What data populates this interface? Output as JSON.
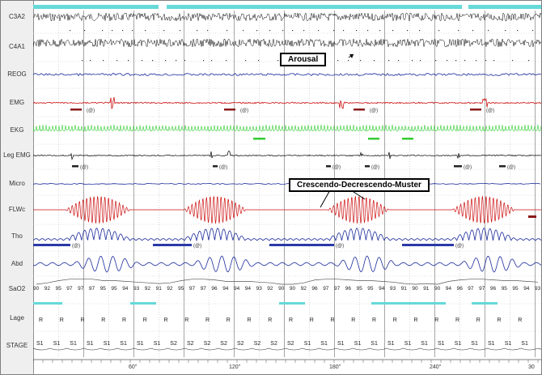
{
  "channels": [
    {
      "name": "C3A2",
      "color": "#000000"
    },
    {
      "name": "C4A1",
      "color": "#000000"
    },
    {
      "name": "REOG",
      "color": "#1a2a9a"
    },
    {
      "name": "EMG",
      "color": "#cc1111"
    },
    {
      "name": "EKG",
      "color": "#33cc33"
    },
    {
      "name": "Leg EMG",
      "color": "#000000"
    },
    {
      "name": "Micro",
      "color": "#1a2a9a"
    },
    {
      "name": "FLWc",
      "color": "#cc1111"
    },
    {
      "name": "Tho",
      "color": "#1a2a9a"
    },
    {
      "name": "Abd",
      "color": "#1a2a9a"
    },
    {
      "name": "SaO2",
      "color": "#000000"
    },
    {
      "name": "Lage",
      "color": "#000000"
    },
    {
      "name": "STAGE",
      "color": "#000000"
    }
  ],
  "annotations": {
    "arousal": "Arousal",
    "crescendo": "Crescendo-Decrescendo-Muster"
  },
  "event_marker": "(@)",
  "time_axis": {
    "labels": [
      "60\"",
      "120\"",
      "180\"",
      "240\"",
      "30"
    ]
  },
  "sao2_values": [
    "90",
    "92",
    "95",
    "97",
    "97",
    "97",
    "95",
    "95",
    "94",
    "93",
    "92",
    "91",
    "92",
    "95",
    "97",
    "97",
    "96",
    "94",
    "94",
    "94",
    "93",
    "92",
    "90",
    "90",
    "92",
    "96",
    "97",
    "97",
    "96",
    "95",
    "95",
    "94",
    "93",
    "91",
    "90",
    "91",
    "90",
    "94",
    "96",
    "97",
    "97",
    "96",
    "95",
    "95",
    "94",
    "93"
  ],
  "lage_values": [
    "R",
    "R",
    "R",
    "R",
    "R",
    "R",
    "R",
    "R",
    "R",
    "R",
    "R",
    "R",
    "R",
    "R",
    "R",
    "R",
    "R",
    "R",
    "R",
    "R",
    "R",
    "R",
    "R",
    "R"
  ],
  "stage_values": [
    "S1",
    "S1",
    "S1",
    "S1",
    "S1",
    "S1",
    "S1",
    "S1",
    "S2",
    "S2",
    "S2",
    "S2",
    "S2",
    "S2",
    "S2",
    "S2",
    "S1",
    "S1",
    "S1",
    "S1",
    "S1",
    "S1",
    "S1",
    "S1",
    "S1",
    "S1",
    "S1",
    "S1",
    "S1",
    "S1"
  ],
  "colors": {
    "cyan_bar": "#66d9d9",
    "grid": "#909090",
    "eeg": "#000000",
    "blue": "#1a2a9a",
    "red": "#cc1111",
    "green": "#33cc33"
  }
}
